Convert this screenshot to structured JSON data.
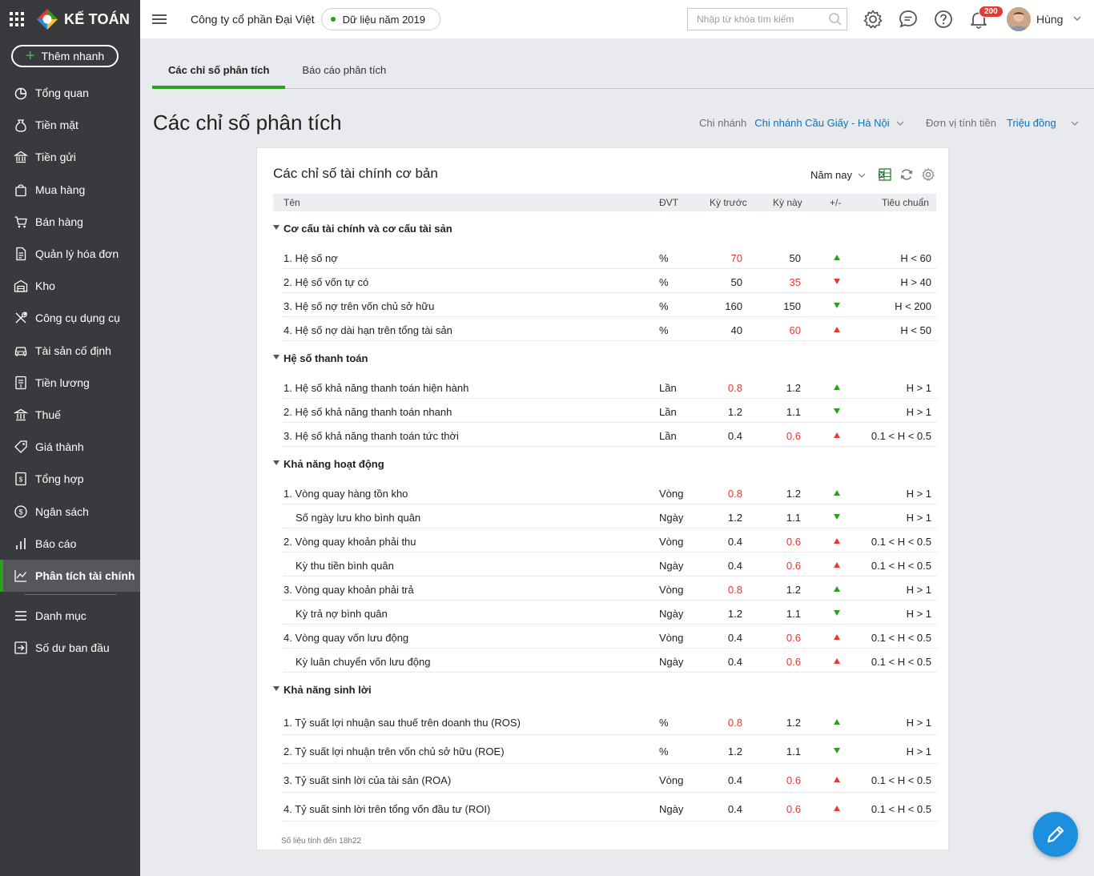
{
  "brand": {
    "name": "KẾ TOÁN"
  },
  "sidebar": {
    "quick_add": "Thêm nhanh",
    "items": [
      {
        "label": "Tổng quan",
        "icon": "dashboard-icon"
      },
      {
        "label": "Tiền mặt",
        "icon": "money-bag-icon"
      },
      {
        "label": "Tiền gửi",
        "icon": "bank-icon"
      },
      {
        "label": "Mua hàng",
        "icon": "shopping-bag-icon"
      },
      {
        "label": "Bán hàng",
        "icon": "cart-icon"
      },
      {
        "label": "Quản lý hóa đơn",
        "icon": "invoice-icon"
      },
      {
        "label": "Kho",
        "icon": "warehouse-icon"
      },
      {
        "label": "Công cụ dụng cụ",
        "icon": "tools-icon"
      },
      {
        "label": "Tài sản cố định",
        "icon": "car-icon"
      },
      {
        "label": "Tiền lương",
        "icon": "payroll-icon"
      },
      {
        "label": "Thuế",
        "icon": "tax-icon"
      },
      {
        "label": "Giá thành",
        "icon": "price-tag-icon"
      },
      {
        "label": "Tổng hợp",
        "icon": "summary-icon"
      },
      {
        "label": "Ngân sách",
        "icon": "budget-icon"
      },
      {
        "label": "Báo cáo",
        "icon": "report-icon"
      },
      {
        "label": "Phân tích tài chính",
        "icon": "analytics-icon",
        "active": true
      },
      {
        "label": "Danh mục",
        "icon": "list-icon"
      },
      {
        "label": "Số dư ban đầu",
        "icon": "opening-balance-icon"
      }
    ]
  },
  "topbar": {
    "company": "Công ty cổ phần Đại Việt",
    "year": "Dữ liệu năm 2019",
    "search_placeholder": "Nhập từ khóa tìm kiếm",
    "notifications": "200",
    "user": "Hùng"
  },
  "tabs": [
    "Các chỉ số phân tích",
    "Báo cáo phân tích"
  ],
  "page": {
    "title": "Các chỉ số phân tích",
    "branch_label": "Chi nhánh",
    "branch_value": "Chi nhánh Cầu Giấy - Hà Nội",
    "currency_label": "Đơn vị tính tiền",
    "currency_value": "Triệu đồng"
  },
  "card": {
    "title": "Các chỉ số tài chính cơ bản",
    "period": "Năm nay",
    "headers": {
      "name": "Tên",
      "unit": "ĐVT",
      "prev": "Kỳ trước",
      "cur": "Kỳ này",
      "diff": "+/-",
      "std": "Tiêu chuẩn"
    },
    "footnote": "Số liệu tính đến 18h22"
  },
  "groups": [
    {
      "name": "Cơ cấu tài chính và cơ cấu tài sản",
      "rows": [
        {
          "name": "1. Hệ số nợ",
          "unit": "%",
          "prev": "70",
          "prev_red": true,
          "cur": "50",
          "cur_red": false,
          "arrow": "up-green",
          "std": "H < 60"
        },
        {
          "name": "2. Hệ số vốn tự có",
          "unit": "%",
          "prev": "50",
          "prev_red": false,
          "cur": "35",
          "cur_red": true,
          "arrow": "down-red",
          "std": "H > 40"
        },
        {
          "name": "3. Hệ số nợ trên vốn chủ sở hữu",
          "unit": "%",
          "prev": "160",
          "prev_red": false,
          "cur": "150",
          "cur_red": false,
          "arrow": "down-green",
          "std": "H < 200"
        },
        {
          "name": "4. Hệ số nợ dài hạn trên tổng tài sản",
          "unit": "%",
          "prev": "40",
          "prev_red": false,
          "cur": "60",
          "cur_red": true,
          "arrow": "up-red",
          "std": "H < 50"
        }
      ]
    },
    {
      "name": "Hệ số thanh toán",
      "rows": [
        {
          "name": "1. Hệ số khả năng thanh toán hiện hành",
          "unit": "Lần",
          "prev": "0.8",
          "prev_red": true,
          "cur": "1.2",
          "cur_red": false,
          "arrow": "up-green",
          "std": "H > 1"
        },
        {
          "name": "2. Hệ số khả năng thanh toán nhanh",
          "unit": "Lần",
          "prev": "1.2",
          "prev_red": false,
          "cur": "1.1",
          "cur_red": false,
          "arrow": "down-green",
          "std": "H > 1"
        },
        {
          "name": "3. Hệ số khả năng thanh toán tức thời",
          "unit": "Lần",
          "prev": "0.4",
          "prev_red": false,
          "cur": "0.6",
          "cur_red": true,
          "arrow": "up-red",
          "std": "0.1 < H < 0.5"
        }
      ]
    },
    {
      "name": "Khả năng hoạt động",
      "rows": [
        {
          "name": "1. Vòng quay hàng tồn kho",
          "unit": "Vòng",
          "prev": "0.8",
          "prev_red": true,
          "cur": "1.2",
          "cur_red": false,
          "arrow": "up-green",
          "std": "H > 1"
        },
        {
          "name": "Số ngày lưu kho bình quân",
          "sub": true,
          "unit": "Ngày",
          "prev": "1.2",
          "prev_red": false,
          "cur": "1.1",
          "cur_red": false,
          "arrow": "down-green",
          "std": "H > 1"
        },
        {
          "name": "2. Vòng quay khoản phải thu",
          "unit": "Vòng",
          "prev": "0.4",
          "prev_red": false,
          "cur": "0.6",
          "cur_red": true,
          "arrow": "up-red",
          "std": "0.1 < H < 0.5"
        },
        {
          "name": "Kỳ thu tiền bình quân",
          "sub": true,
          "unit": "Ngày",
          "prev": "0.4",
          "prev_red": false,
          "cur": "0.6",
          "cur_red": true,
          "arrow": "up-red",
          "std": "0.1 < H < 0.5"
        },
        {
          "name": "3. Vòng quay khoản phải trả",
          "unit": "Vòng",
          "prev": "0.8",
          "prev_red": true,
          "cur": "1.2",
          "cur_red": false,
          "arrow": "up-green",
          "std": "H > 1"
        },
        {
          "name": "Kỳ trả nợ bình quân",
          "sub": true,
          "unit": "Ngày",
          "prev": "1.2",
          "prev_red": false,
          "cur": "1.1",
          "cur_red": false,
          "arrow": "down-green",
          "std": "H > 1"
        },
        {
          "name": "4. Vòng quay vốn lưu động",
          "unit": "Vòng",
          "prev": "0.4",
          "prev_red": false,
          "cur": "0.6",
          "cur_red": true,
          "arrow": "up-red",
          "std": "0.1 < H < 0.5"
        },
        {
          "name": "Kỳ luân chuyển vốn lưu động",
          "sub": true,
          "unit": "Ngày",
          "prev": "0.4",
          "prev_red": false,
          "cur": "0.6",
          "cur_red": true,
          "arrow": "up-red",
          "std": "0.1 < H < 0.5"
        }
      ]
    },
    {
      "name": "Khả năng sinh lời",
      "rows": [
        {
          "name": "1. Tỷ suất lợi nhuận sau thuế trên doanh thu (ROS)",
          "unit": "%",
          "prev": "0.8",
          "prev_red": true,
          "cur": "1.2",
          "cur_red": false,
          "arrow": "up-green",
          "std": "H > 1",
          "tall": true
        },
        {
          "name": "2. Tỷ suất lợi nhuận trên vốn chủ sở hữu (ROE)",
          "unit": "%",
          "prev": "1.2",
          "prev_red": false,
          "cur": "1.1",
          "cur_red": false,
          "arrow": "down-green",
          "std": "H > 1",
          "tall": true
        },
        {
          "name": "3. Tỷ suất sinh lời của tài sản (ROA)",
          "unit": "Vòng",
          "prev": "0.4",
          "prev_red": false,
          "cur": "0.6",
          "cur_red": true,
          "arrow": "up-red",
          "std": "0.1 < H < 0.5",
          "tall": true
        },
        {
          "name": "4. Tỷ suất sinh lời trên tổng vốn đầu tư (ROI)",
          "unit": "Ngày",
          "prev": "0.4",
          "prev_red": false,
          "cur": "0.6",
          "cur_red": true,
          "arrow": "up-red",
          "std": "0.1 < H < 0.5",
          "tall": true
        }
      ]
    }
  ],
  "colors": {
    "accent": "#2ca01c",
    "link": "#0077c5",
    "negative": "#e53935",
    "sidebar": "#393a3d",
    "fab": "#1d8fdf"
  }
}
